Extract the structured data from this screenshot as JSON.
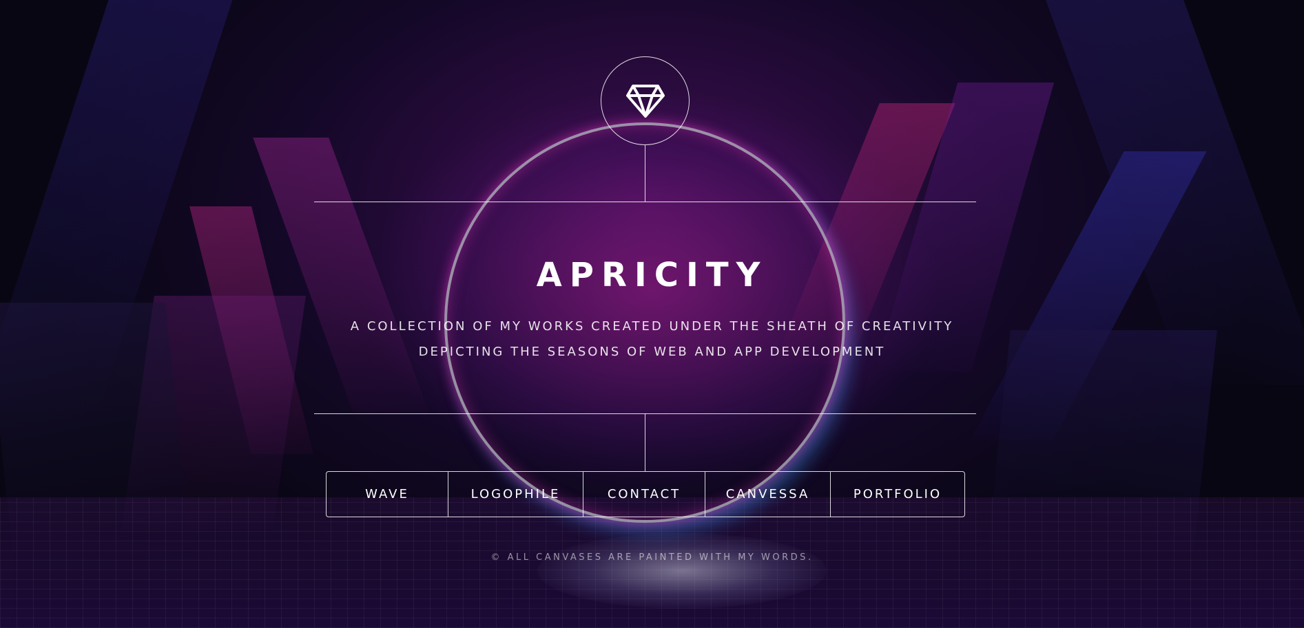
{
  "brand": {
    "logo_icon": "diamond-icon",
    "title": "APRICITY",
    "subtitle_line1": "A COLLECTION OF MY WORKS CREATED UNDER THE SHEATH OF CREATIVITY",
    "subtitle_line2": "DEPICTING THE SEASONS OF WEB AND APP DEVELOPMENT"
  },
  "nav": {
    "items": [
      {
        "label": "WAVE"
      },
      {
        "label": "LOGOPHILE"
      },
      {
        "label": "CONTACT"
      },
      {
        "label": "CANVESSA"
      },
      {
        "label": "PORTFOLIO"
      }
    ]
  },
  "footer": {
    "text": "© ALL CANVASES ARE PAINTED WITH MY WORDS."
  },
  "colors": {
    "line": "#ffffff",
    "accent_magenta": "#c0208c",
    "accent_blue": "#3a2aa0",
    "background_dark": "#0b0818"
  }
}
